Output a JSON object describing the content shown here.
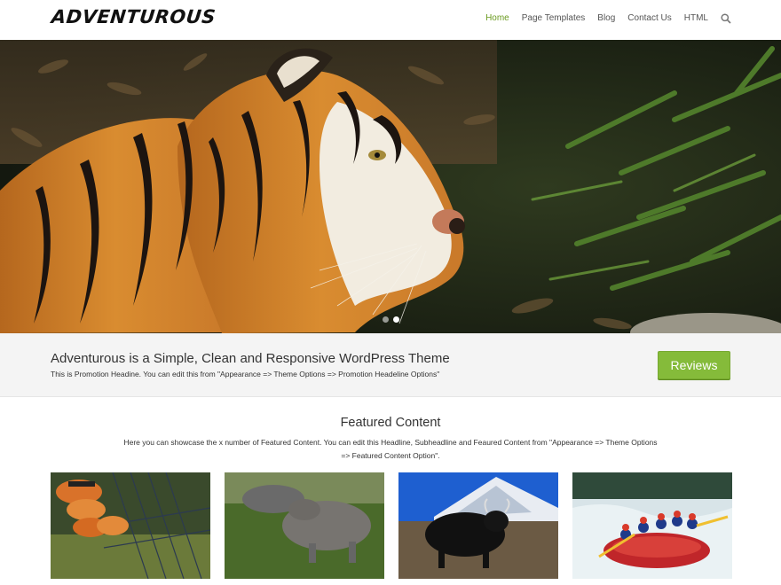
{
  "site": {
    "logo_text": "ADVENTUROUS"
  },
  "nav": {
    "items": [
      {
        "label": "Home",
        "active": true
      },
      {
        "label": "Page Templates",
        "active": false
      },
      {
        "label": "Blog",
        "active": false
      },
      {
        "label": "Contact Us",
        "active": false
      },
      {
        "label": "HTML",
        "active": false
      }
    ],
    "search_icon": "search-icon"
  },
  "hero": {
    "image": "tiger-photo",
    "slides": 2,
    "active_slide": 2
  },
  "promo": {
    "title": "Adventurous is a Simple, Clean and Responsive WordPress Theme",
    "subtitle": "This is Promotion Headine. You can edit this from \"Appearance => Theme Options => Promotion Headeline Options\"",
    "button_label": "Reviews"
  },
  "featured": {
    "title": "Featured Content",
    "subtitle_line1": "Here you can showcase the x number of Featured Content. You can edit this Headline, Subheadline and Feaured Content from \"Appearance => Theme Options",
    "subtitle_line2": "=> Featured Content Option\".",
    "items": [
      "climbing-shoes-photo",
      "rhinos-photo",
      "yak-mountain-photo",
      "river-rafting-photo"
    ]
  },
  "colors": {
    "accent": "#6a9a1f",
    "button": "#85bb3a",
    "promo_bg": "#f4f4f4"
  }
}
